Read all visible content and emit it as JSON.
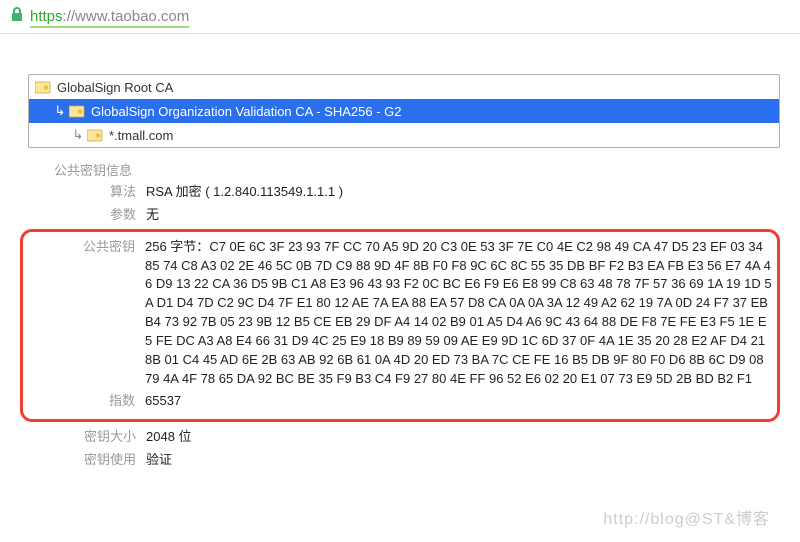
{
  "address_bar": {
    "scheme": "https",
    "rest": "://www.taobao.com"
  },
  "chain": {
    "row0": "GlobalSign Root CA",
    "row1": "GlobalSign Organization Validation CA - SHA256 - G2",
    "row2": "*.tmall.com"
  },
  "section_title": "公共密钥信息",
  "rows": {
    "algo_label": "算法",
    "algo_value": "RSA 加密 ( 1.2.840.113549.1.1.1 )",
    "param_label": "参数",
    "param_value": "无",
    "pubkey_label": "公共密钥",
    "pubkey_prefix": "256 字节：",
    "pubkey_hex": "C7 0E 6C 3F 23 93 7F CC 70 A5 9D 20 C3 0E 53 3F 7E C0 4E C2 98 49 CA 47 D5 23 EF 03 34 85 74 C8 A3 02 2E 46 5C 0B 7D C9 88 9D 4F 8B F0 F8 9C 6C 8C 55 35 DB BF F2 B3 EA FB E3 56 E7 4A 46 D9 13 22 CA 36 D5 9B C1 A8 E3 96 43 93 F2 0C BC E6 F9 E6 E8 99 C8 63 48 78 7F 57 36 69 1A 19 1D 5A D1 D4 7D C2 9C D4 7F E1 80 12 AE 7A EA 88 EA 57 D8 CA 0A 0A 3A 12 49 A2 62 19 7A 0D 24 F7 37 EB B4 73 92 7B 05 23 9B 12 B5 CE EB 29 DF A4 14 02 B9 01 A5 D4 A6 9C 43 64 88 DE F8 7E FE E3 F5 1E E5 FE DC A3 A8 E4 66 31 D9 4C 25 E9 18 B9 89 59 09 AE E9 9D 1C 6D 37 0F 4A 1E 35 20 28 E2 AF D4 21 8B 01 C4 45 AD 6E 2B 63 AB 92 6B 61 0A 4D 20 ED 73 BA 7C CE FE 16 B5 DB 9F 80 F0 D6 8B 6C D9 08 79 4A 4F 78 65 DA 92 BC BE 35 F9 B3 C4 F9 27 80 4E FF 96 52 E6 02 20 E1 07 73 E9 5D 2B BD B2 F1",
    "exp_label": "指数",
    "exp_value": "65537",
    "keysize_label": "密钥大小",
    "keysize_value": "2048 位",
    "keyusage_label": "密钥使用",
    "keyusage_value": "验证"
  },
  "watermark": "http://blog@ST&博客"
}
